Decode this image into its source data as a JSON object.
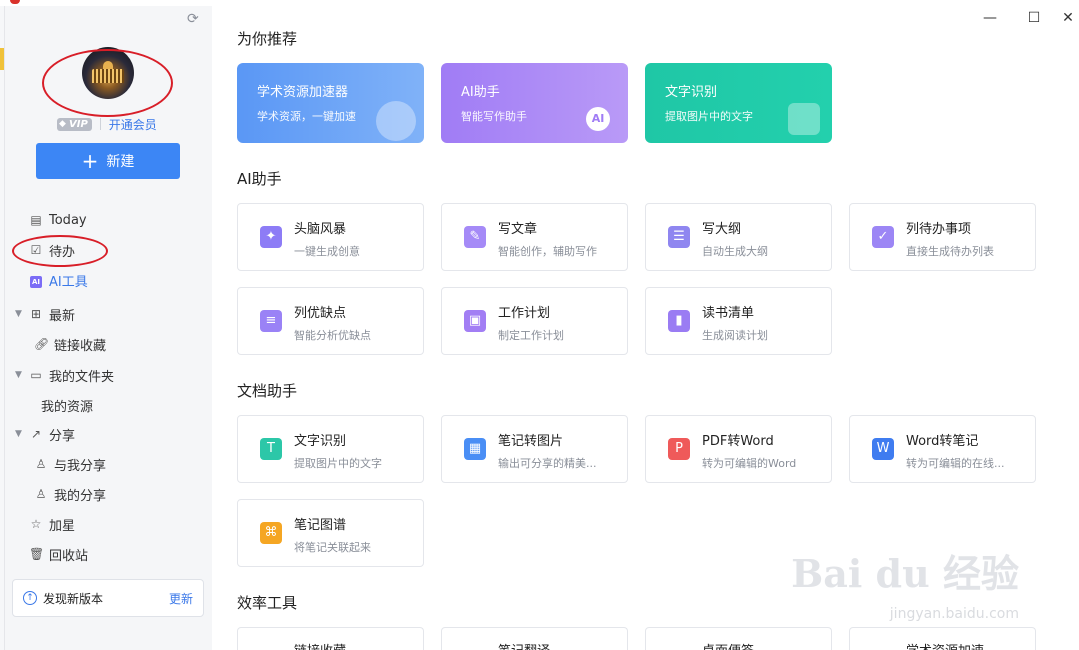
{
  "sidebar": {
    "vip_badge": "VIP",
    "vip_link": "开通会员",
    "new_button": "新建",
    "nav": {
      "today": "Today",
      "todo": "待办",
      "ai_tools": "AI工具",
      "ai_badge": "AI",
      "recent": "最新",
      "link_collect": "链接收藏",
      "my_folders": "我的文件夹",
      "my_resources": "我的资源",
      "share": "分享",
      "shared_with_me": "与我分享",
      "my_shares": "我的分享",
      "starred": "加星",
      "trash": "回收站"
    },
    "update": {
      "label": "发现新版本",
      "action": "更新"
    }
  },
  "main": {
    "sections": {
      "recommend": "为你推荐",
      "ai": "AI助手",
      "doc": "文档助手",
      "efficiency": "效率工具"
    },
    "recommend": [
      {
        "title": "学术资源加速器",
        "subtitle": "学术资源，一键加速"
      },
      {
        "title": "AI助手",
        "subtitle": "智能写作助手",
        "badge": "AI"
      },
      {
        "title": "文字识别",
        "subtitle": "提取图片中的文字"
      }
    ],
    "ai_tools": [
      {
        "title": "头脑风暴",
        "subtitle": "一键生成创意"
      },
      {
        "title": "写文章",
        "subtitle": "智能创作，辅助写作"
      },
      {
        "title": "写大纲",
        "subtitle": "自动生成大纲"
      },
      {
        "title": "列待办事项",
        "subtitle": "直接生成待办列表"
      },
      {
        "title": "列优缺点",
        "subtitle": "智能分析优缺点"
      },
      {
        "title": "工作计划",
        "subtitle": "制定工作计划"
      },
      {
        "title": "读书清单",
        "subtitle": "生成阅读计划"
      }
    ],
    "doc_tools": [
      {
        "title": "文字识别",
        "subtitle": "提取图片中的文字"
      },
      {
        "title": "笔记转图片",
        "subtitle": "输出可分享的精美..."
      },
      {
        "title": "PDF转Word",
        "subtitle": "转为可编辑的Word"
      },
      {
        "title": "Word转笔记",
        "subtitle": "转为可编辑的在线..."
      },
      {
        "title": "笔记图谱",
        "subtitle": "将笔记关联起来"
      }
    ],
    "efficiency_tools": [
      {
        "title": "链接收藏"
      },
      {
        "title": "笔记翻译"
      },
      {
        "title": "桌面便签"
      },
      {
        "title": "学术资源加速"
      }
    ]
  },
  "watermark": {
    "brand": "Bai du 经验",
    "url": "jingyan.baidu.com"
  },
  "colors": {
    "accent": "#3c86f5",
    "annotation": "#d81e28"
  }
}
